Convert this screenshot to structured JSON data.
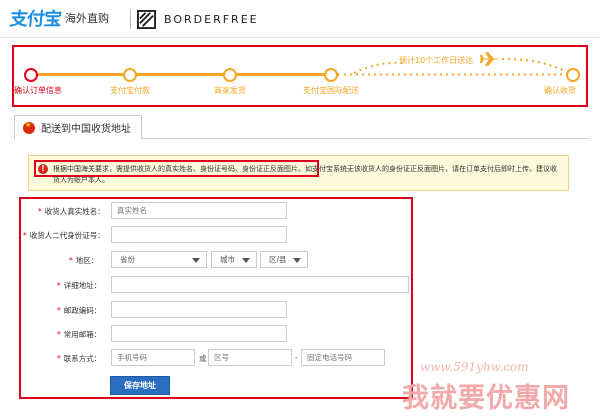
{
  "header": {
    "alipay_logo": "支付宝",
    "alipay_subtitle": "海外直购",
    "partner_logo": "BORDERFREE"
  },
  "progress": {
    "estimate": "预计10个工作日送达",
    "steps": [
      {
        "label": "确认订单信息",
        "active": true
      },
      {
        "label": "支付宝付款",
        "active": false
      },
      {
        "label": "商家发货",
        "active": false
      },
      {
        "label": "支付宝国际配送",
        "active": false
      },
      {
        "label": "确认收货",
        "active": false
      }
    ]
  },
  "tab": {
    "label": "配送到中国收货地址"
  },
  "notice": {
    "icon": "!",
    "text": "根据中国海关要求，需提供收货人的真实姓名、身份证号码、身份证正反面图片。如支付宝系统无该收货人的身份证正反面图片，请在订单支付后即时上传。建议收货人为账户本人。"
  },
  "form": {
    "required_mark": "*",
    "name_label": "收货人真实姓名：",
    "name_placeholder": "真实姓名",
    "id_label": "收货人二代身份证号：",
    "region_label": "地区：",
    "province": "省份",
    "city": "城市",
    "district": "区/县",
    "address_label": "详细地址：",
    "postcode_label": "邮政编码：",
    "email_label": "常用邮箱：",
    "contact_label": "联系方式：",
    "mobile_placeholder": "手机号码",
    "or_text": "或",
    "area_code_placeholder": "区号",
    "dash": "-",
    "landline_placeholder": "固定电话号码",
    "save_label": "保存地址"
  },
  "watermark": {
    "url": "www.591yhw.com",
    "text": "我就要优惠网"
  },
  "colors": {
    "accent_red": "#e0001b",
    "progress_orange": "#f5a623",
    "button_blue": "#2a6ebf"
  }
}
